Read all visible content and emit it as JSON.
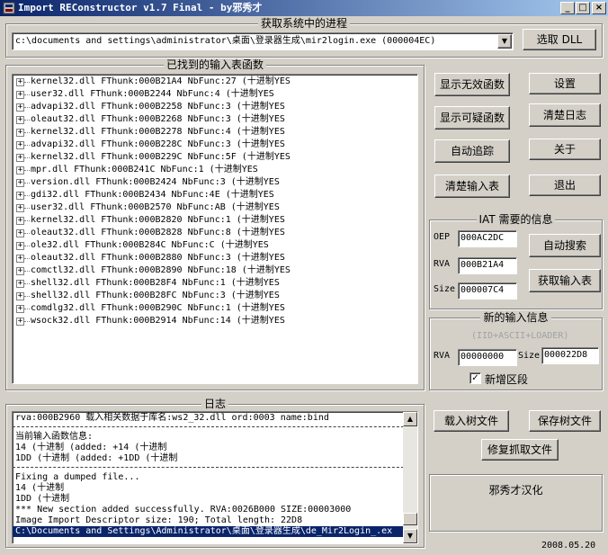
{
  "window": {
    "title": "Import REConstructor v1.7 Final - by邪秀才",
    "minimize": "_",
    "maximize": "□",
    "close": "×"
  },
  "process_group": {
    "title": "获取系统中的进程",
    "selected_process": "c:\\documents and settings\\administrator\\桌面\\登录器生成\\mir2login.exe (000004EC)",
    "pick_dll_button": "选取 DLL"
  },
  "imports_group": {
    "title": "已找到的输入表函数",
    "items": [
      "kernel32.dll FThunk:000B21A4 NbFunc:27 (十进制YES",
      "user32.dll FThunk:000B2244 NbFunc:4 (十进制YES",
      "advapi32.dll FThunk:000B2258 NbFunc:3 (十进制YES",
      "oleaut32.dll FThunk:000B2268 NbFunc:3 (十进制YES",
      "kernel32.dll FThunk:000B2278 NbFunc:4 (十进制YES",
      "advapi32.dll FThunk:000B228C NbFunc:3 (十进制YES",
      "kernel32.dll FThunk:000B229C NbFunc:5F (十进制YES",
      "mpr.dll FThunk:000B241C NbFunc:1 (十进制YES",
      "version.dll FThunk:000B2424 NbFunc:3 (十进制YES",
      "gdi32.dll FThunk:000B2434 NbFunc:4E (十进制YES",
      "user32.dll FThunk:000B2570 NbFunc:AB (十进制YES",
      "kernel32.dll FThunk:000B2820 NbFunc:1 (十进制YES",
      "oleaut32.dll FThunk:000B2828 NbFunc:8 (十进制YES",
      "ole32.dll FThunk:000B284C NbFunc:C (十进制YES",
      "oleaut32.dll FThunk:000B2880 NbFunc:3 (十进制YES",
      "comctl32.dll FThunk:000B2890 NbFunc:18 (十进制YES",
      "shell32.dll FThunk:000B28F4 NbFunc:1 (十进制YES",
      "shell32.dll FThunk:000B28FC NbFunc:3 (十进制YES",
      "comdlg32.dll FThunk:000B290C NbFunc:1 (十进制YES",
      "wsock32.dll FThunk:000B2914 NbFunc:14 (十进制YES"
    ]
  },
  "left_buttons": {
    "show_invalid": "显示无效函数",
    "show_suspect": "显示可疑函数",
    "auto_trace": "自动追踪",
    "clear_imports": "清楚输入表"
  },
  "right_buttons": {
    "settings": "设置",
    "clear_log": "清楚日志",
    "about": "关于",
    "exit": "退出"
  },
  "iat_group": {
    "title": "IAT 需要的信息",
    "oep_label": "OEP",
    "oep_value": "000AC2DC",
    "rva_label": "RVA",
    "rva_value": "000B21A4",
    "size_label": "Size",
    "size_value": "000007C4",
    "auto_search": "自动搜索",
    "get_imports": "获取输入表"
  },
  "new_import_group": {
    "title": "新的输入信息",
    "hint": "(IID+ASCII+LOADER)",
    "rva_label": "RVA",
    "rva_value": "00000000",
    "size_label": "Size",
    "size_value": "000022D8",
    "add_section_label": "新增区段",
    "add_section_checked": true
  },
  "log_group": {
    "title": "日志",
    "lines": [
      {
        "text": "rva:000B2960 载入相关数据于库名:ws2_32.dll ord:0003 name:bind",
        "type": "text"
      },
      {
        "text": "",
        "type": "sep"
      },
      {
        "text": "当前输入函数信息:",
        "type": "text"
      },
      {
        "text": "14 (十进制 (added: +14 (十进制",
        "type": "text"
      },
      {
        "text": "1DD (十进制 (added: +1DD (十进制",
        "type": "text"
      },
      {
        "text": "",
        "type": "sep"
      },
      {
        "text": "Fixing a dumped file...",
        "type": "text"
      },
      {
        "text": "14 (十进制",
        "type": "text"
      },
      {
        "text": "1DD (十进制",
        "type": "text"
      },
      {
        "text": "*** New section added successfully. RVA:0026B000 SIZE:00003000",
        "type": "text"
      },
      {
        "text": "Image Import Descriptor size: 190; Total length: 22D8",
        "type": "text"
      },
      {
        "text": "C:\\Documents and Settings\\Administrator\\桌面\\登录器生成\\de_Mir2Login_.ex",
        "type": "selected"
      }
    ]
  },
  "tree_buttons": {
    "load_tree": "载入树文件",
    "save_tree": "保存树文件",
    "fix_dump": "修复抓取文件"
  },
  "credit": "邪秀才汉化",
  "date": "2008.05.20"
}
